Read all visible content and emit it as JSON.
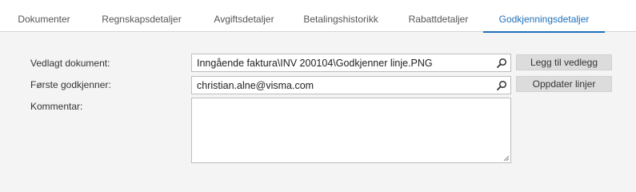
{
  "tabs": [
    {
      "label": "Dokumenter"
    },
    {
      "label": "Regnskapsdetaljer"
    },
    {
      "label": "Avgiftsdetaljer"
    },
    {
      "label": "Betalingshistorikk"
    },
    {
      "label": "Rabattdetaljer"
    },
    {
      "label": "Godkjenningsdetaljer"
    }
  ],
  "active_tab": "Godkjenningsdetaljer",
  "form": {
    "attachment": {
      "label": "Vedlagt dokument:",
      "value": "Inngående faktura\\INV 200104\\Godkjenner linje.PNG"
    },
    "first_approver": {
      "label": "Første godkjenner:",
      "value": "christian.alne@visma.com"
    },
    "comment": {
      "label": "Kommentar:",
      "value": ""
    }
  },
  "buttons": {
    "add_attachment": "Legg til vedlegg",
    "update_lines": "Oppdater linjer"
  },
  "icons": {
    "search": "search-icon",
    "resize": "resize-grip-icon"
  },
  "colors": {
    "accent": "#1e6fb8",
    "background": "#f4f4f4",
    "button": "#dcdcdc"
  }
}
